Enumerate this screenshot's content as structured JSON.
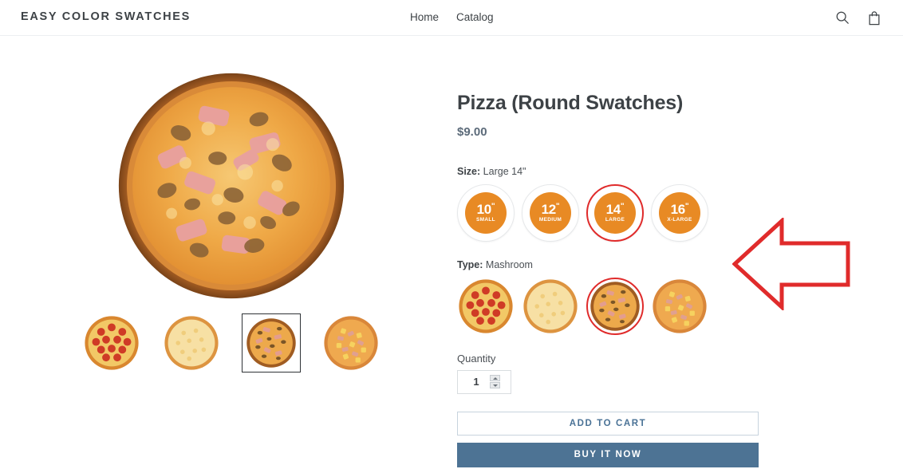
{
  "header": {
    "logo": "EASY COLOR SWATCHES",
    "nav": [
      {
        "label": "Home"
      },
      {
        "label": "Catalog"
      }
    ],
    "icons": {
      "search": "search-icon",
      "cart": "shopping-bag-icon"
    }
  },
  "product": {
    "title": "Pizza (Round Swatches)",
    "price": "$9.00",
    "size_option": {
      "label": "Size:",
      "selected_value": "Large 14\"",
      "swatches": [
        {
          "inch": "10",
          "unit": "\"",
          "name": "SMALL",
          "value": "Small 10\"",
          "selected": false
        },
        {
          "inch": "12",
          "unit": "\"",
          "name": "MEDIUM",
          "value": "Medium 12\"",
          "selected": false
        },
        {
          "inch": "14",
          "unit": "\"",
          "name": "LARGE",
          "value": "Large 14\"",
          "selected": true
        },
        {
          "inch": "16",
          "unit": "\"",
          "name": "X-LARGE",
          "value": "X-Large 16\"",
          "selected": false
        }
      ]
    },
    "type_option": {
      "label": "Type:",
      "selected_value": "Mashroom",
      "swatches": [
        {
          "name": "Pepperoni",
          "selected": false
        },
        {
          "name": "Cheese",
          "selected": false
        },
        {
          "name": "Mashroom",
          "selected": true
        },
        {
          "name": "Hawaiian",
          "selected": false
        }
      ]
    },
    "quantity": {
      "label": "Quantity",
      "value": "1"
    },
    "add_to_cart_label": "ADD TO CART",
    "buy_now_label": "BUY IT NOW",
    "gallery": {
      "hero_alt": "Mashroom pizza",
      "thumbs": [
        {
          "name": "Pepperoni",
          "selected": false
        },
        {
          "name": "Cheese",
          "selected": false
        },
        {
          "name": "Mashroom",
          "selected": true
        },
        {
          "name": "Hawaiian",
          "selected": false
        }
      ]
    }
  },
  "annotation": {
    "arrow": "left-pointing-arrow",
    "color": "#e02b2b"
  },
  "colors": {
    "swatch_orange": "#e88a24",
    "selected_ring": "#e02b2b",
    "buy_button": "#4d7394",
    "add_button_text": "#4a7296",
    "heading": "#3d4246"
  }
}
